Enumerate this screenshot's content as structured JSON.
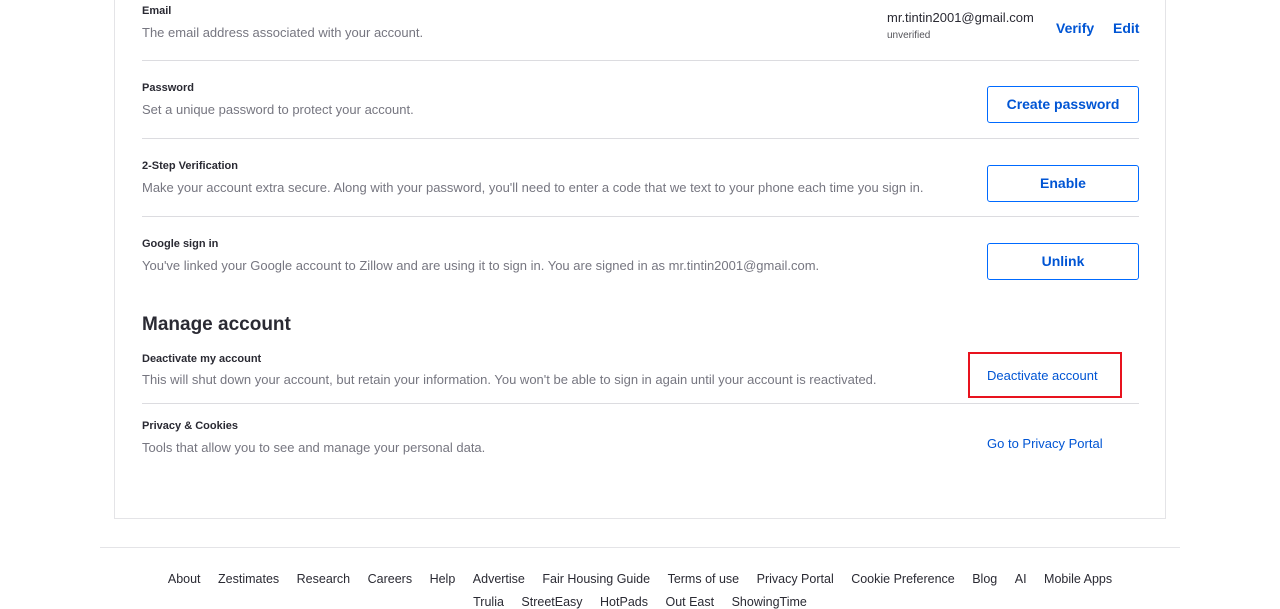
{
  "account": {
    "email": {
      "title": "Email",
      "description": "The email address associated with your account.",
      "value": "mr.tintin2001@gmail.com",
      "status": "unverified",
      "verify_label": "Verify",
      "edit_label": "Edit"
    },
    "password": {
      "title": "Password",
      "description": "Set a unique password to protect your account.",
      "button_label": "Create password"
    },
    "two_step": {
      "title": "2-Step Verification",
      "description": "Make your account extra secure. Along with your password, you'll need to enter a code that we text to your phone each time you sign in.",
      "button_label": "Enable"
    },
    "google": {
      "title": "Google sign in",
      "description": "You've linked your Google account to Zillow and are using it to sign in. You are signed in as mr.tintin2001@gmail.com.",
      "button_label": "Unlink"
    }
  },
  "manage": {
    "heading": "Manage account",
    "deactivate": {
      "title": "Deactivate my account",
      "description": "This will shut down your account, but retain your information. You won't be able to sign in again until your account is reactivated.",
      "link_label": "Deactivate account"
    },
    "privacy": {
      "title": "Privacy & Cookies",
      "description": "Tools that allow you to see and manage your personal data.",
      "link_label": "Go to Privacy Portal"
    }
  },
  "footer": {
    "links": [
      "About",
      "Zestimates",
      "Research",
      "Careers",
      "Help",
      "Advertise",
      "Fair Housing Guide",
      "Terms of use",
      "Privacy Portal",
      "Cookie Preference",
      "Blog",
      "AI",
      "Mobile Apps"
    ],
    "links2": [
      "Trulia",
      "StreetEasy",
      "HotPads",
      "Out East",
      "ShowingTime"
    ]
  },
  "colors": {
    "link": "#0055d4",
    "highlight": "#e8131e"
  }
}
